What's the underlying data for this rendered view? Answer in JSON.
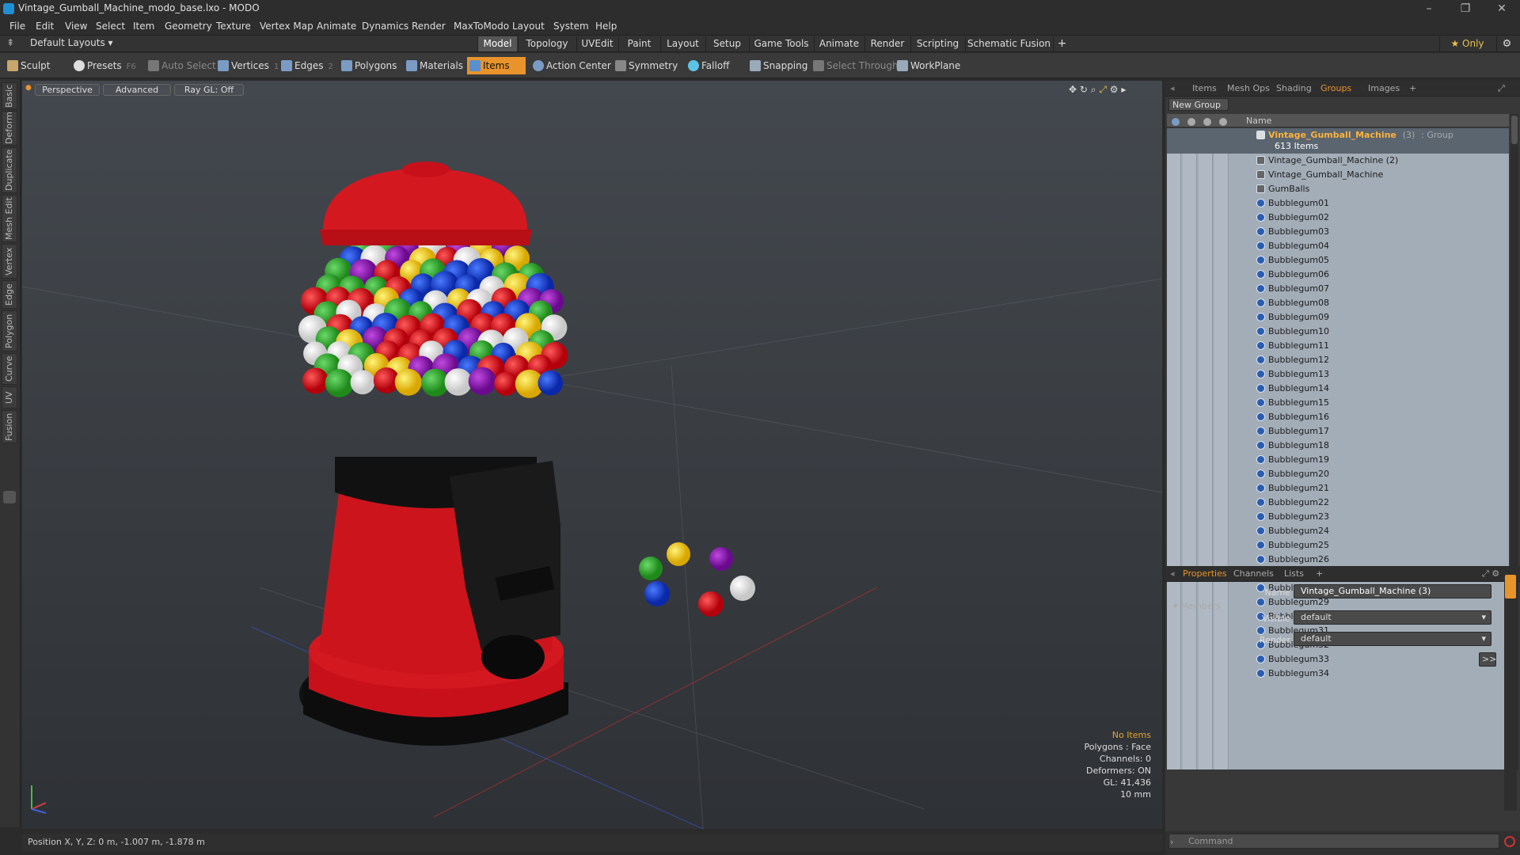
{
  "window": {
    "title": "Vintage_Gumball_Machine_modo_base.lxo - MODO"
  },
  "menu": [
    "File",
    "Edit",
    "View",
    "Select",
    "Item",
    "Geometry",
    "Texture",
    "Vertex Map",
    "Animate",
    "Dynamics",
    "Render",
    "MaxToModo",
    "Layout",
    "System",
    "Help"
  ],
  "layout": {
    "selector": "Default Layouts ▾",
    "tabs": [
      "Model",
      "Topology",
      "UVEdit",
      "Paint",
      "Layout",
      "Setup",
      "Game Tools",
      "Animate",
      "Render",
      "Scripting",
      "Schematic Fusion"
    ],
    "active_tab": "Model",
    "add": "+",
    "only": "★  Only",
    "gear": "⚙"
  },
  "toolbar": {
    "sculpt": "Sculpt",
    "presets": "Presets",
    "presets_key": "F6",
    "auto_select": "Auto Select",
    "vertices": "Vertices",
    "vertices_count": "1",
    "edges": "Edges",
    "edges_count": "2",
    "polygons": "Polygons",
    "materials": "Materials",
    "items": "Items",
    "action_center": "Action Center",
    "symmetry": "Symmetry",
    "falloff": "Falloff",
    "snapping": "Snapping",
    "select_through": "Select Through",
    "workplane": "WorkPlane"
  },
  "left_tabs": [
    "Basic",
    "Deform",
    "Duplicate",
    "Mesh Edit",
    "Vertex",
    "Edge",
    "Polygon",
    "Curve",
    "UV",
    "Fusion"
  ],
  "viewport": {
    "view": "Perspective",
    "shading": "Advanced",
    "raygl": "Ray GL: Off",
    "info": {
      "items": "No Items",
      "polygons": "Polygons : Face",
      "channels": "Channels: 0",
      "deformers": "Deformers: ON",
      "gl": "GL: 41,436",
      "scale": "10 mm"
    }
  },
  "status": {
    "position": "Position X, Y, Z:  0 m, -1.007 m, -1.878 m"
  },
  "panel": {
    "tabs": [
      "Items",
      "Mesh Ops",
      "Shading",
      "Groups",
      "Images"
    ],
    "active_tab": "Groups",
    "add": "+",
    "new_group": "New Group",
    "column_name": "Name",
    "group": {
      "name": "Vintage_Gumball_Machine",
      "suffix": "(3)",
      "type": ": Group",
      "count": "613 Items"
    },
    "children": [
      "Vintage_Gumball_Machine (2)",
      "Vintage_Gumball_Machine",
      "GumBalls",
      "Bubblegum01",
      "Bubblegum02",
      "Bubblegum03",
      "Bubblegum04",
      "Bubblegum05",
      "Bubblegum06",
      "Bubblegum07",
      "Bubblegum08",
      "Bubblegum09",
      "Bubblegum10",
      "Bubblegum11",
      "Bubblegum12",
      "Bubblegum13",
      "Bubblegum14",
      "Bubblegum15",
      "Bubblegum16",
      "Bubblegum17",
      "Bubblegum18",
      "Bubblegum19",
      "Bubblegum20",
      "Bubblegum21",
      "Bubblegum22",
      "Bubblegum23",
      "Bubblegum24",
      "Bubblegum25",
      "Bubblegum26",
      "Bubblegum27",
      "Bubblegum28",
      "Bubblegum29",
      "Bubblegum30",
      "Bubblegum31",
      "Bubblegum32",
      "Bubblegum33",
      "Bubblegum34"
    ]
  },
  "properties": {
    "tabs": [
      "Properties",
      "Channels",
      "Lists"
    ],
    "active_tab": "Properties",
    "add": "+",
    "name_label": "Name",
    "name_value": "Vintage_Gumball_Machine (3)",
    "members": "Members",
    "visible_label": "Visible",
    "visible_value": "default",
    "render_label": "Render",
    "render_value": "default",
    "more": ">>",
    "command_placeholder": "Command"
  },
  "colors": {
    "accent": "#e8942a",
    "group_name": "#ffb23b",
    "list_bg": "#a3adb8"
  }
}
